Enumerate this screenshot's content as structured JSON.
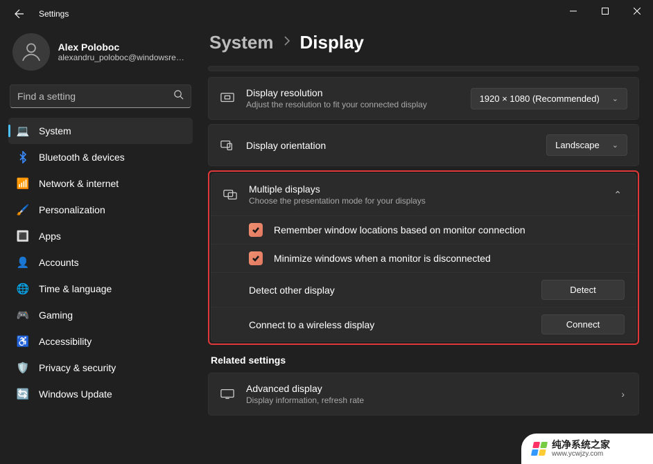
{
  "window": {
    "title": "Settings"
  },
  "user": {
    "name": "Alex Poloboc",
    "email": "alexandru_poloboc@windowsreport..."
  },
  "search": {
    "placeholder": "Find a setting"
  },
  "nav": {
    "items": [
      {
        "label": "System",
        "icon": "💻",
        "active": true
      },
      {
        "label": "Bluetooth & devices",
        "icon": "bt"
      },
      {
        "label": "Network & internet",
        "icon": "📶"
      },
      {
        "label": "Personalization",
        "icon": "🖌️"
      },
      {
        "label": "Apps",
        "icon": "🔳"
      },
      {
        "label": "Accounts",
        "icon": "👤"
      },
      {
        "label": "Time & language",
        "icon": "🌐"
      },
      {
        "label": "Gaming",
        "icon": "🎮"
      },
      {
        "label": "Accessibility",
        "icon": "♿"
      },
      {
        "label": "Privacy & security",
        "icon": "🛡️"
      },
      {
        "label": "Windows Update",
        "icon": "🔄"
      }
    ]
  },
  "breadcrumb": {
    "parent": "System",
    "current": "Display"
  },
  "resolution": {
    "title": "Display resolution",
    "subtitle": "Adjust the resolution to fit your connected display",
    "value": "1920 × 1080 (Recommended)"
  },
  "orientation": {
    "title": "Display orientation",
    "value": "Landscape"
  },
  "multiple": {
    "title": "Multiple displays",
    "subtitle": "Choose the presentation mode for your displays",
    "remember": {
      "checked": true,
      "label": "Remember window locations based on monitor connection"
    },
    "minimize": {
      "checked": true,
      "label": "Minimize windows when a monitor is disconnected"
    },
    "detect": {
      "label": "Detect other display",
      "button": "Detect"
    },
    "wireless": {
      "label": "Connect to a wireless display",
      "button": "Connect"
    }
  },
  "related": {
    "heading": "Related settings"
  },
  "advanced": {
    "title": "Advanced display",
    "subtitle": "Display information, refresh rate"
  },
  "watermark": {
    "name": "纯净系统之家",
    "url": "www.ycwjzy.com"
  }
}
